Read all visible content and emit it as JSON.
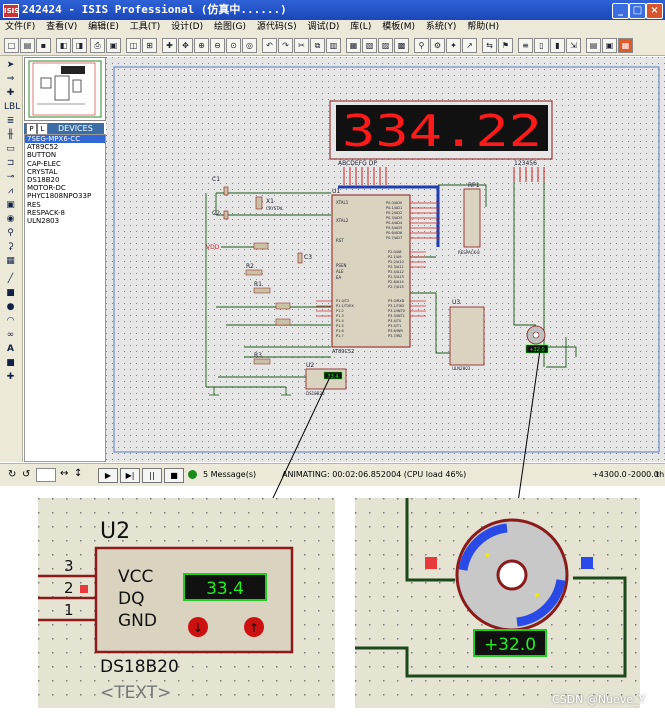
{
  "window": {
    "app_icon_text": "ISIS",
    "title": "242424 - ISIS Professional (仿真中......)",
    "minimize": "_",
    "maximize": "□",
    "close": "×"
  },
  "menu": {
    "items": [
      "文件(F)",
      "查看(V)",
      "编辑(E)",
      "工具(T)",
      "设计(D)",
      "绘图(G)",
      "源代码(S)",
      "调试(D)",
      "库(L)",
      "模板(M)",
      "系统(Y)",
      "帮助(H)"
    ]
  },
  "device_panel": {
    "p_label": "P",
    "l_label": "L",
    "header": "DEVICES",
    "items": [
      "7SEG-MPX6-CC",
      "AT89C52",
      "BUTTON",
      "CAP-ELEC",
      "CRYSTAL",
      "DS18B20",
      "MOTOR-DC",
      "PHYC1808NPO33P",
      "RES",
      "RESPACK-8",
      "ULN2803"
    ],
    "selected_index": 0
  },
  "schematic": {
    "display_digits": "334.22",
    "display_pins_left": "ABCDEFG DP",
    "display_pins_right": "123456",
    "u1_label": "U1",
    "u1_part": "AT89C52",
    "u2_label": "U2",
    "u2_part": "DS18B20",
    "u2_small_reading": "33.4",
    "u3_label": "U3",
    "u3_part": "ULN2803",
    "rp1_label": "RP1",
    "rp1_part": "RESPACK-8",
    "c1": "C1",
    "c2": "C2",
    "c3": "C3",
    "x1": "X1",
    "x1_part": "CRYSTAL",
    "r1": "R1",
    "r2": "R2",
    "r3": "R3",
    "vdd": "VDD",
    "motor_small_reading": "+32.0",
    "xtal1": "XTAL1",
    "xtal2": "XTAL2",
    "rst": "RST",
    "psen": "PSEN",
    "ale": "ALE",
    "ea": "EA",
    "p0_pins": [
      "P0.0/AD0",
      "P0.1/AD1",
      "P0.2/AD2",
      "P0.3/AD3",
      "P0.4/AD4",
      "P0.5/AD5",
      "P0.6/AD6",
      "P0.7/AD7"
    ],
    "p2_pins": [
      "P2.0/A8",
      "P2.1/A9",
      "P2.2/A10",
      "P2.3/A11",
      "P2.4/A12",
      "P2.5/A13",
      "P2.6/A14",
      "P2.7/A15"
    ],
    "p3_pins": [
      "P3.0/RXD",
      "P3.1/TXD",
      "P3.2/INT0",
      "P3.3/INT1",
      "P3.4/T0",
      "P3.5/T1",
      "P3.6/WR",
      "P3.7/RD"
    ],
    "p1_pins": [
      "P1.0/T2",
      "P1.1/T2EX",
      "P1.2",
      "P1.3",
      "P1.4",
      "P1.5",
      "P1.6",
      "P1.7"
    ]
  },
  "statusbar": {
    "message_count": "5 Message(s)",
    "animating": "ANIMATING: 00:02:06.852004 (CPU load 46%)",
    "coord_x": "+4300.0",
    "coord_y": "-2000.0",
    "tail": "th",
    "play_icons": [
      "▶",
      "▶|",
      "||",
      "■"
    ]
  },
  "zoom_ds18b20": {
    "ref": "U2",
    "pin_numbers": [
      "3",
      "2",
      "1"
    ],
    "pin_names": [
      "VCC",
      "DQ",
      "GND"
    ],
    "reading": "33.4",
    "part": "DS18B20",
    "text_placeholder": "<TEXT>"
  },
  "zoom_motor": {
    "reading": "+32.0"
  },
  "watermark": "CSDN @Nueve_Y",
  "colors": {
    "titlebar": "#1a47b8",
    "wire_green": "#1a5a1a",
    "display_red": "#ff1a1a",
    "chip_fill": "#d9d3c0",
    "chip_border": "#8b1a1a",
    "reading_green": "#00e000",
    "bus_blue": "#1f3fb0"
  }
}
